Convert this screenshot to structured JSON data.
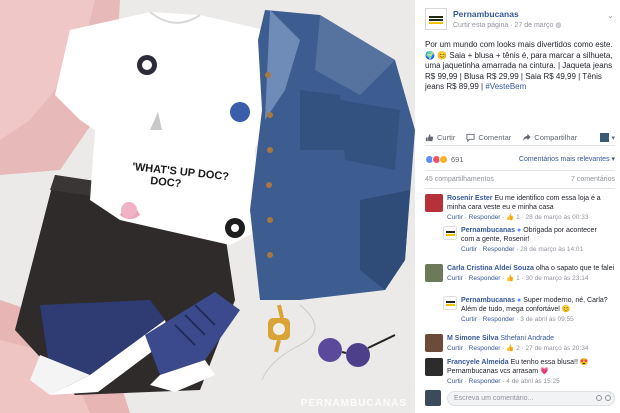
{
  "photo": {
    "watermark": "PERNAMBUCANAS",
    "shirt_print": "'WHAT'S UP DOC?"
  },
  "post": {
    "page_name": "Pernambucanas",
    "curtir_pagina": "Curtir esta página",
    "date": "27 de março",
    "text_before_hashtag": "Por um mundo com looks mais divertidos como este. 🌍 😊 Saia + blusa + tênis é, para marcar a silhueta, uma jaquetinha amarrada na cintura. | Jaqueta jeans R$ 99,99 | Blusa R$ 29,99 | Saia R$ 49,99 | Tênis jeans R$ 89,99 |",
    "hashtag": "#VesteBem"
  },
  "actions": {
    "like": "Curtir",
    "comment": "Comentar",
    "share": "Compartilhar"
  },
  "reactions": {
    "count": "691",
    "sort": "Comentários mais relevantes ▾"
  },
  "stats": {
    "shares": "45 compartilhamentos",
    "comments": "7 comentários"
  },
  "comments": [
    {
      "author": "Rosenir Ester",
      "text": "Eu me identifico com essa loja é a minha cara veste eu e minha casa",
      "like": "Curtir",
      "reply": "Responder",
      "meta": "· 👍 1 · 28 de março às 00:33",
      "reply_item": {
        "author": "Pernambucanas",
        "text": "Obrigada por acontecer com a gente, Rosenir!",
        "like": "Curtir",
        "reply": "Responder",
        "meta": "· 28 de março às 14:01"
      }
    },
    {
      "author": "Carla Cristina Aldeí Souza",
      "text": "olha o sapato que te falei",
      "like": "Curtir",
      "reply": "Responder",
      "meta": "· 👍 1 · 30 de março às 23:14",
      "reply_item": {
        "author": "Pernambucanas",
        "text": "Super moderno, né, Carla? Além de tudo, mega confortável 😊",
        "like": "Curtir",
        "reply": "Responder",
        "meta": "· 3 de abril às 09:55"
      }
    },
    {
      "author": "M Simone Silva",
      "text": "Sthefani Andrade",
      "like": "Curtir",
      "reply": "Responder",
      "meta": "· 👍 2 · 27 de março às 20:34"
    },
    {
      "author": "Francyele Almeida",
      "text": "Eu tenho essa blusa!! 😍 Pernambucanas vcs arrasam 💗",
      "like": "Curtir",
      "reply": "Responder",
      "meta": "· 4 de abril às 15:25"
    }
  ],
  "composer": {
    "placeholder": "Escreva um comentário..."
  },
  "colors": {
    "link": "#365899",
    "muted": "#90949c",
    "like_blue": "#5890ff"
  }
}
